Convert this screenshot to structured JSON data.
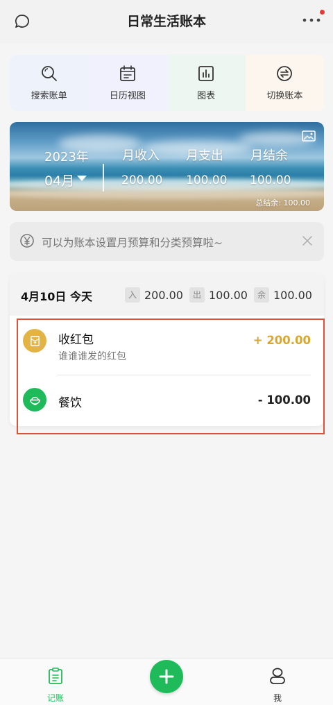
{
  "header": {
    "title": "日常生活账本"
  },
  "quick_actions": [
    {
      "label": "搜索账单",
      "icon": "search-icon"
    },
    {
      "label": "日历视图",
      "icon": "calendar-icon"
    },
    {
      "label": "图表",
      "icon": "chart-icon"
    },
    {
      "label": "切换账本",
      "icon": "switch-icon"
    }
  ],
  "summary": {
    "year": "2023年",
    "month": "04月",
    "income_label": "月收入",
    "expense_label": "月支出",
    "balance_label": "月结余",
    "income": "200.00",
    "expense": "100.00",
    "balance": "100.00",
    "total": "总结余: 100.00"
  },
  "tip": {
    "text": "可以为账本设置月预算和分类预算啦~"
  },
  "day": {
    "date": "4月10日 今天",
    "in_tag": "入",
    "in": "200.00",
    "out_tag": "出",
    "out": "100.00",
    "rest_tag": "余",
    "rest": "100.00"
  },
  "transactions": [
    {
      "name": "收红包",
      "note": "谁谁谁发的红包",
      "amount": "+ 200.00",
      "icon": "red-envelope-icon",
      "color": "#e3b444"
    },
    {
      "name": "餐饮",
      "note": "",
      "amount": "- 100.00",
      "icon": "rice-bowl-icon",
      "color": "#1fbb5b"
    }
  ],
  "tabs": {
    "ledger": "记账",
    "me": "我"
  },
  "colors": {
    "accent": "#1fbb5b",
    "income": "#d9a72f",
    "highlight": "#d9533c"
  }
}
